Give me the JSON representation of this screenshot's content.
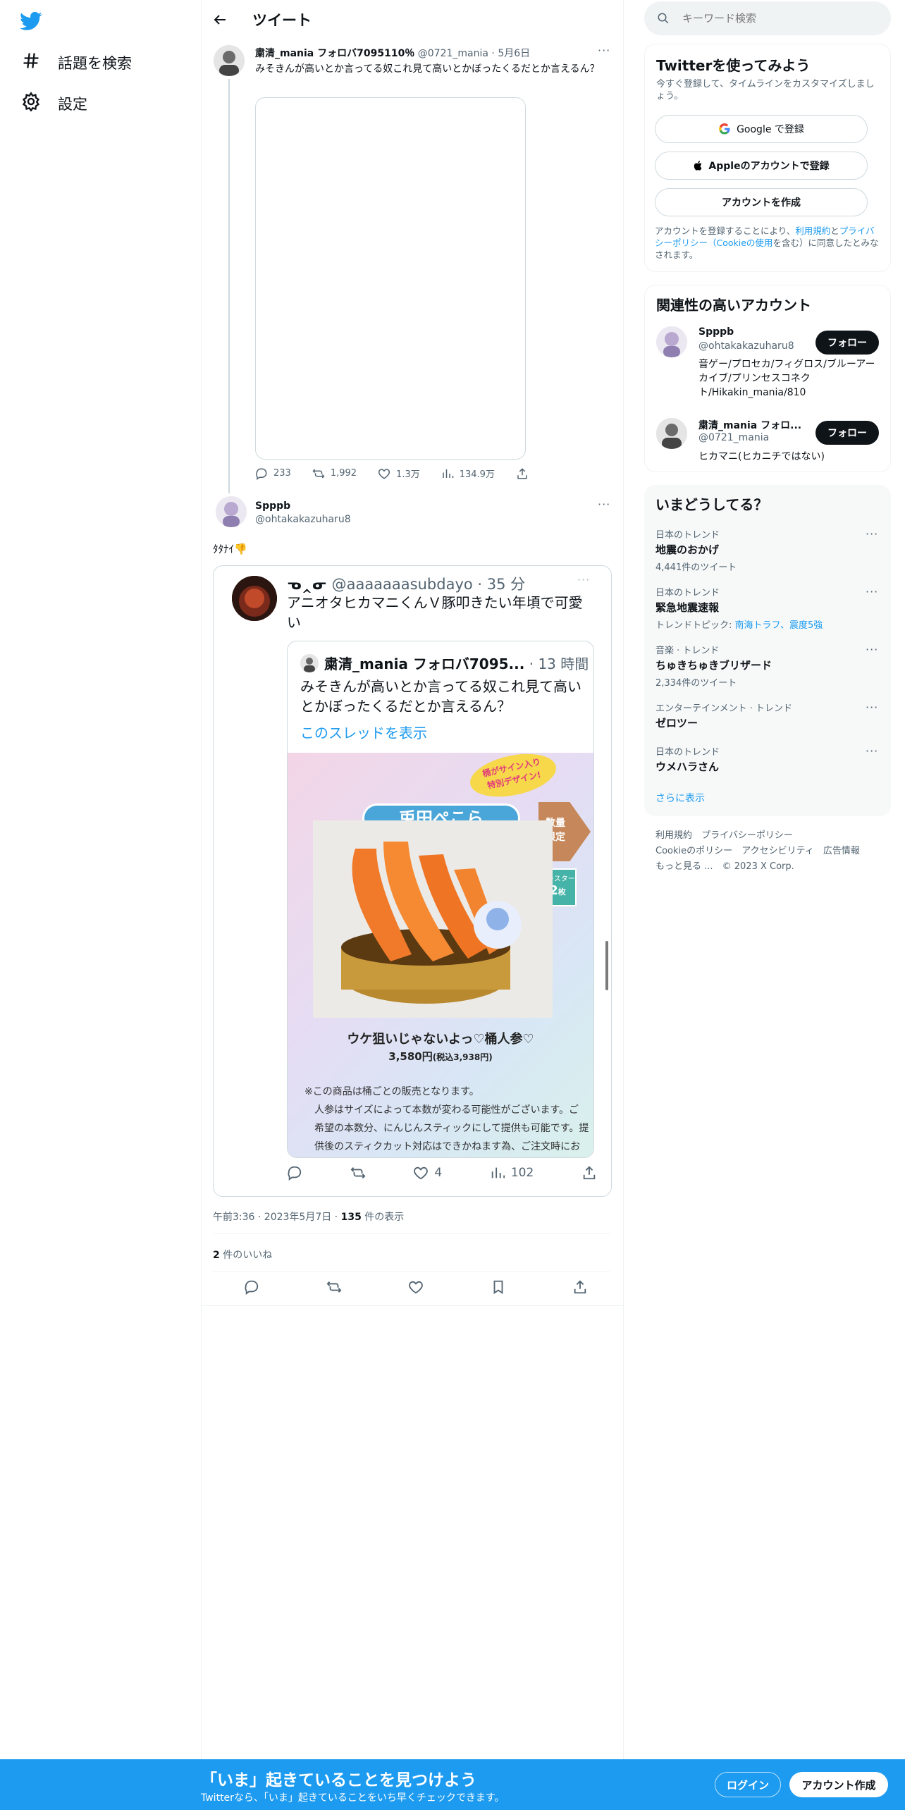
{
  "nav": {
    "explore_label": "話題を検索",
    "settings_label": "設定"
  },
  "header": {
    "title": "ツイート"
  },
  "quoted_parent": {
    "name": "粛清_mania フォロバ7095110％",
    "handle": "@0721_mania",
    "date": "5月6日",
    "text": "みそきんが高いとか言ってる奴これ見て高いとかぼったくるだとか言えるん？",
    "stats": {
      "replies": "233",
      "retweets": "1,992",
      "likes": "1.3万",
      "views": "134.9万"
    }
  },
  "main_tweet": {
    "name": "Spppb",
    "handle": "@ohtakakazuharu8",
    "text": "ﾀﾀﾅｲ👎",
    "embed": {
      "author_name": "ᓀ‸ᓂ",
      "handle": "@aaaaaaasubdayo",
      "time": "35 分",
      "text": "アニオタヒカマニくんＶ豚叩きたい年頃で可愛い",
      "inner": {
        "name": "粛清_mania フォロバ7095...",
        "time": "13 時間",
        "text": "みそきんが高いとか言ってる奴これ見て高いとかぼったくるだとか言えるん？",
        "thread_link": "このスレッドを表示"
      },
      "product": {
        "badge_top": "桶がサイン入り",
        "badge_top2": "特別デザイン!",
        "name_banner": "兎田ぺこら",
        "limited": "数量",
        "limited2": "限定",
        "coaster": "コースター",
        "coaster_count": "2",
        "coaster_unit": "枚",
        "title": "ウケ狙いじゃないよっ♡桶人参♡",
        "price": "3,580円",
        "price_tax": "(税込3,938円)",
        "note1": "※この商品は桶ごとの販売となります。",
        "note2": "人参はサイズによって本数が変わる可能性がございます。ご",
        "note3": "希望の本数分、にんじんスティックにして提供も可能です。提",
        "note4": "供後のスティクカット対応はできかねます為、ご注文時にお"
      },
      "likes": "4",
      "views": "102"
    },
    "timestamp": "午前3:36 · 2023年5月7日 · ",
    "view_count": "135",
    "view_suffix": " 件の表示",
    "like_count": "2",
    "like_suffix": " 件のいいね"
  },
  "sidebar": {
    "search_placeholder": "キーワード検索",
    "signup": {
      "title": "Twitterを使ってみよう",
      "subtitle": "今すぐ登録して、タイムラインをカスタマイズしましょう。",
      "google": "Google で登録",
      "apple": "Appleのアカウントで登録",
      "create": "アカウントを作成",
      "legal_prefix": "アカウントを登録することにより、",
      "terms": "利用規約",
      "and": "と",
      "privacy": "プライバシーポリシー（Cookieの使用",
      "legal_suffix": "を含む）に同意したとみなされます。"
    },
    "relevant": {
      "title": "関連性の高いアカウント",
      "accounts": [
        {
          "name": "Spppb",
          "handle": "@ohtakakazuharu8",
          "bio": "音ゲー/プロセカ/フィグロス/ブルーアーカイブ/プリンセスコネクト/Hikakin_mania/810",
          "follow": "フォロー"
        },
        {
          "name": "粛清_mania フォロ...",
          "handle": "@0721_mania",
          "bio": "ヒカマニ(ヒカニチではない)",
          "follow": "フォロー"
        }
      ]
    },
    "trends": {
      "title": "いまどうしてる？",
      "items": [
        {
          "category": "日本のトレンド",
          "name": "地震のおかげ",
          "sub": "4,441件のツイート"
        },
        {
          "category": "日本のトレンド",
          "name": "緊急地震速報",
          "sub_prefix": "トレンドトピック: ",
          "sub_links": "南海トラフ、震度5強"
        },
        {
          "category": "音楽 · トレンド",
          "name": "ちゅきちゅきブリザード",
          "sub": "2,334件のツイート"
        },
        {
          "category": "エンターテインメント · トレンド",
          "name": "ゼロツー"
        },
        {
          "category": "日本のトレンド",
          "name": "ウメハラさん"
        }
      ],
      "show_more": "さらに表示"
    },
    "footer": {
      "terms": "利用規約",
      "privacy": "プライバシーポリシー",
      "cookie": "Cookieのポリシー",
      "access": "アクセシビリティ",
      "ads": "広告情報",
      "more": "もっと見る ...",
      "copyright": "© 2023 X Corp."
    }
  },
  "bottom_bar": {
    "title": "「いま」起きていることを見つけよう",
    "subtitle": "Twitterなら、「いま」起きていることをいち早くチェックできます。",
    "login": "ログイン",
    "signup": "アカウント作成"
  },
  "colors": {
    "accent": "#1d9bf0",
    "dark": "#0f1419",
    "muted": "#536471",
    "border": "#eff3f4",
    "panel": "#f7f9f9"
  }
}
